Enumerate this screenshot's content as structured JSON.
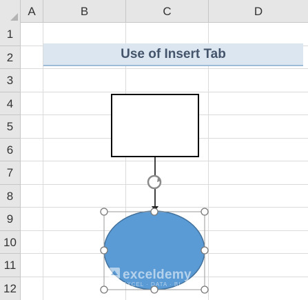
{
  "columns": [
    "A",
    "B",
    "C",
    "D"
  ],
  "rows": [
    "1",
    "2",
    "3",
    "4",
    "5",
    "6",
    "7",
    "8",
    "9",
    "10",
    "11",
    "12"
  ],
  "title": "Use of Insert Tab",
  "watermark": {
    "name": "exceldemy",
    "tagline": "EXCEL · DATA · BI"
  },
  "colors": {
    "header_bg": "#e6e6e6",
    "title_fill": "#dce6f1",
    "title_text": "#44546a",
    "oval_fill": "#5b9bd5",
    "oval_stroke": "#41719c",
    "rect_stroke": "#000000"
  },
  "shapes": {
    "rectangle": {
      "type": "rectangle",
      "fill": "#ffffff",
      "stroke": "#000000"
    },
    "connector": {
      "type": "straight-connector"
    },
    "oval": {
      "type": "oval",
      "selected": true
    },
    "rotate_handle": {
      "icon": "rotate-icon"
    }
  }
}
